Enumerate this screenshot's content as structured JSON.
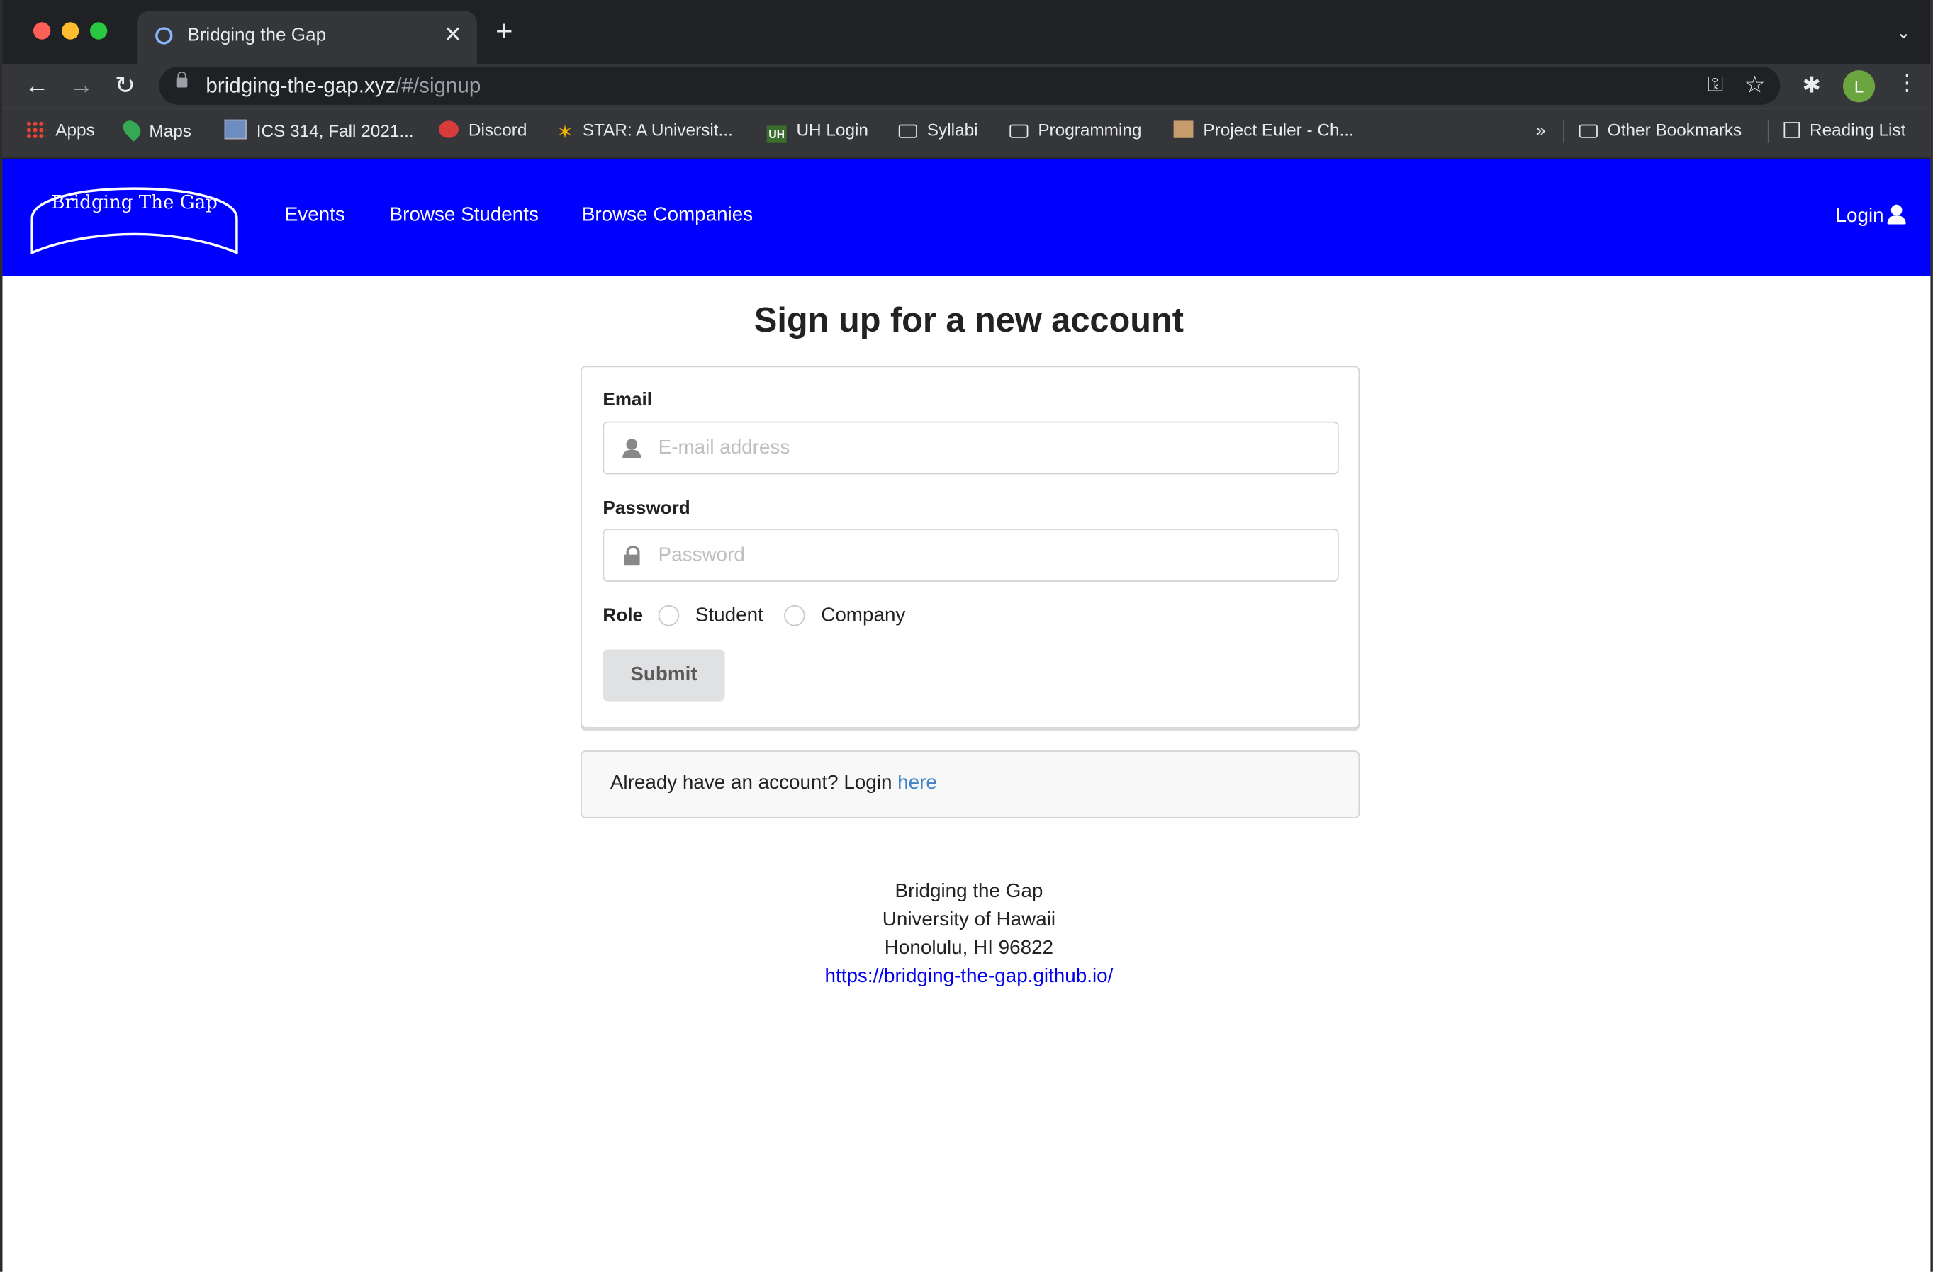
{
  "browser": {
    "tab_title": "Bridging the Gap",
    "tab_close": "✕",
    "new_tab": "+",
    "url_host": "bridging-the-gap.xyz",
    "url_path": "/#/signup",
    "avatar_letter": "L",
    "bookmarks": [
      {
        "label": "Apps",
        "icon": "apps-grid-icon"
      },
      {
        "label": "Maps",
        "icon": "maps-pin-icon"
      },
      {
        "label": "ICS 314, Fall 2021...",
        "icon": "page-icon"
      },
      {
        "label": "Discord",
        "icon": "discord-icon"
      },
      {
        "label": "STAR: A Universit...",
        "icon": "star-logo-icon"
      },
      {
        "label": "UH Login",
        "icon": "uh-logo-icon"
      },
      {
        "label": "Syllabi",
        "icon": "folder-icon"
      },
      {
        "label": "Programming",
        "icon": "folder-icon"
      },
      {
        "label": "Project Euler - Ch...",
        "icon": "project-euler-icon"
      }
    ],
    "bookmarks_overflow": "»",
    "other_bookmarks": "Other Bookmarks",
    "reading_list": "Reading List"
  },
  "navbar": {
    "logo_text": "Bridging The Gap",
    "links": [
      "Events",
      "Browse Students",
      "Browse Companies"
    ],
    "login": "Login",
    "background": "#0000ff"
  },
  "signup": {
    "title": "Sign up for a new account",
    "email_label": "Email",
    "email_placeholder": "E-mail address",
    "password_label": "Password",
    "password_placeholder": "Password",
    "role_label": "Role",
    "role_options": [
      "Student",
      "Company"
    ],
    "submit": "Submit"
  },
  "message": {
    "text": "Already have an account? Login ",
    "link": "here"
  },
  "footer": {
    "line1": "Bridging the Gap",
    "line2": "University of Hawaii",
    "line3": "Honolulu, HI 96822",
    "link": "https://bridging-the-gap.github.io/"
  }
}
